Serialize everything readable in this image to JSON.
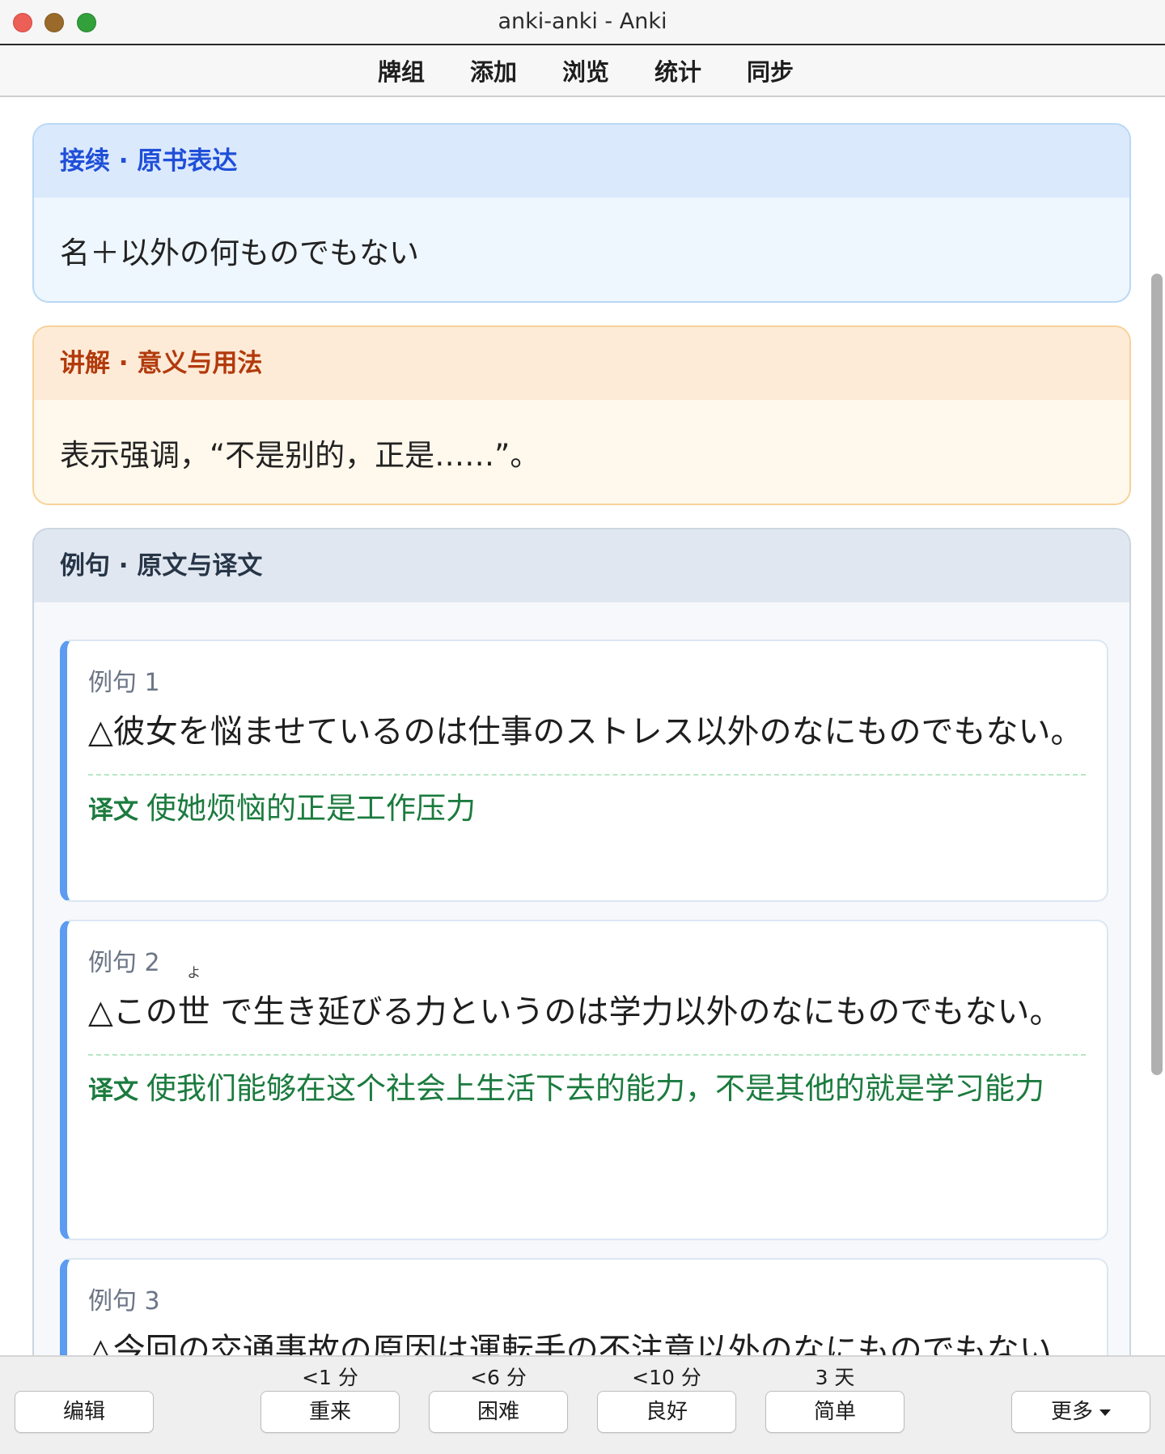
{
  "window": {
    "title": "anki-anki - Anki"
  },
  "toolbar": {
    "items": [
      "牌组",
      "添加",
      "浏览",
      "统计",
      "同步"
    ]
  },
  "sections": {
    "connection": {
      "title": "接续 · 原书表达",
      "content": "名＋以外の何ものでもない"
    },
    "explanation": {
      "title": "讲解 · 意义与用法",
      "content": "表示强调，“不是别的，正是……”。"
    },
    "examples_header": {
      "title": "例句 · 原文与译文"
    }
  },
  "examples": [
    {
      "label": "例句 1",
      "jp": "△彼女を悩ませているのは仕事のストレス以外のなにものでもない。",
      "translation_tag": "译文",
      "translation": "使她烦恼的正是工作压力"
    },
    {
      "label": "例句 2",
      "jp_prefix": "△この",
      "jp_ruby_base": "世",
      "jp_ruby_text": "よ",
      "jp_suffix": " で生き延びる力というのは学力以外のなにものでもない。",
      "translation_tag": "译文",
      "translation": "使我们能够在这个社会上生活下去的能力，不是其他的就是学习能力"
    },
    {
      "label": "例句 3",
      "jp": "△今回の交通事故の原因は運転手の不注意以外のなにものでもない"
    }
  ],
  "answer_bar": {
    "edit": "编辑",
    "again": {
      "label": "重来",
      "interval": "<1 分"
    },
    "hard": {
      "label": "困难",
      "interval": "<6 分"
    },
    "good": {
      "label": "良好",
      "interval": "<10 分"
    },
    "easy": {
      "label": "简单",
      "interval": "3 天"
    },
    "more": "更多"
  },
  "colors": {
    "connection_accent": "#1f4fd8",
    "explanation_accent": "#b23a0c",
    "translation": "#1b7b3e",
    "example_border": "#5b9bf0"
  }
}
